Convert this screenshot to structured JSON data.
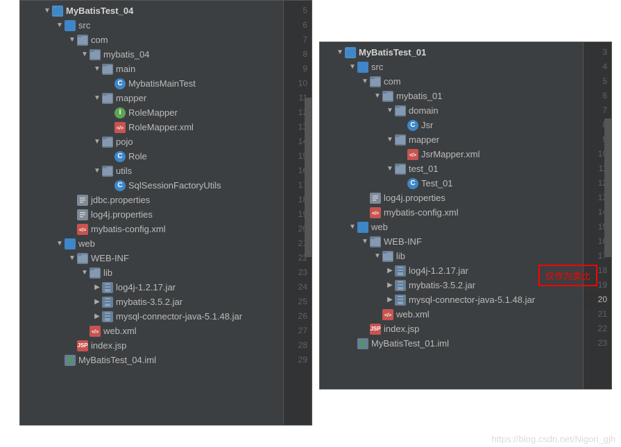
{
  "leftPanel": {
    "startLine": 5,
    "rows": [
      {
        "indent": 0,
        "arrow": "down",
        "icon": "module",
        "label": "MyBatisTest_04",
        "bold": true
      },
      {
        "indent": 1,
        "arrow": "down",
        "icon": "folder-src",
        "label": "src"
      },
      {
        "indent": 2,
        "arrow": "down",
        "icon": "package",
        "label": "com"
      },
      {
        "indent": 3,
        "arrow": "down",
        "icon": "package",
        "label": "mybatis_04"
      },
      {
        "indent": 4,
        "arrow": "down",
        "icon": "package",
        "label": "main"
      },
      {
        "indent": 5,
        "arrow": "",
        "icon": "class-c",
        "label": "MybatisMainTest"
      },
      {
        "indent": 4,
        "arrow": "down",
        "icon": "package",
        "label": "mapper"
      },
      {
        "indent": 5,
        "arrow": "",
        "icon": "class-i",
        "label": "RoleMapper"
      },
      {
        "indent": 5,
        "arrow": "",
        "icon": "xml",
        "label": "RoleMapper.xml"
      },
      {
        "indent": 4,
        "arrow": "down",
        "icon": "package",
        "label": "pojo"
      },
      {
        "indent": 5,
        "arrow": "",
        "icon": "class-c",
        "label": "Role"
      },
      {
        "indent": 4,
        "arrow": "down",
        "icon": "package",
        "label": "utils"
      },
      {
        "indent": 5,
        "arrow": "",
        "icon": "class-c",
        "label": "SqlSessionFactoryUtils"
      },
      {
        "indent": 2,
        "arrow": "",
        "icon": "prop",
        "label": "jdbc.properties"
      },
      {
        "indent": 2,
        "arrow": "",
        "icon": "prop",
        "label": "log4j.properties"
      },
      {
        "indent": 2,
        "arrow": "",
        "icon": "xml",
        "label": "mybatis-config.xml"
      },
      {
        "indent": 1,
        "arrow": "down",
        "icon": "folder-web",
        "label": "web"
      },
      {
        "indent": 2,
        "arrow": "down",
        "icon": "folder",
        "label": "WEB-INF"
      },
      {
        "indent": 3,
        "arrow": "down",
        "icon": "folder",
        "label": "lib"
      },
      {
        "indent": 4,
        "arrow": "right",
        "icon": "jar",
        "label": "log4j-1.2.17.jar"
      },
      {
        "indent": 4,
        "arrow": "right",
        "icon": "jar",
        "label": "mybatis-3.5.2.jar"
      },
      {
        "indent": 4,
        "arrow": "right",
        "icon": "jar",
        "label": "mysql-connector-java-5.1.48.jar"
      },
      {
        "indent": 3,
        "arrow": "",
        "icon": "xml",
        "label": "web.xml"
      },
      {
        "indent": 2,
        "arrow": "",
        "icon": "jsp",
        "label": "index.jsp"
      },
      {
        "indent": 1,
        "arrow": "",
        "icon": "iml",
        "label": "MyBatisTest_04.iml"
      }
    ]
  },
  "rightPanel": {
    "startLine": 3,
    "highlightLine": 20,
    "rows": [
      {
        "indent": 0,
        "arrow": "down",
        "icon": "module",
        "label": "MyBatisTest_01",
        "bold": true
      },
      {
        "indent": 1,
        "arrow": "down",
        "icon": "folder-src",
        "label": "src"
      },
      {
        "indent": 2,
        "arrow": "down",
        "icon": "package",
        "label": "com"
      },
      {
        "indent": 3,
        "arrow": "down",
        "icon": "package",
        "label": "mybatis_01"
      },
      {
        "indent": 4,
        "arrow": "down",
        "icon": "package",
        "label": "domain"
      },
      {
        "indent": 5,
        "arrow": "",
        "icon": "class-c",
        "label": "Jsr"
      },
      {
        "indent": 4,
        "arrow": "down",
        "icon": "package",
        "label": "mapper"
      },
      {
        "indent": 5,
        "arrow": "",
        "icon": "xml",
        "label": "JsrMapper.xml"
      },
      {
        "indent": 4,
        "arrow": "down",
        "icon": "package",
        "label": "test_01"
      },
      {
        "indent": 5,
        "arrow": "",
        "icon": "class-c",
        "label": "Test_01"
      },
      {
        "indent": 2,
        "arrow": "",
        "icon": "prop",
        "label": "log4j.properties"
      },
      {
        "indent": 2,
        "arrow": "",
        "icon": "xml",
        "label": "mybatis-config.xml"
      },
      {
        "indent": 1,
        "arrow": "down",
        "icon": "folder-web",
        "label": "web"
      },
      {
        "indent": 2,
        "arrow": "down",
        "icon": "folder",
        "label": "WEB-INF"
      },
      {
        "indent": 3,
        "arrow": "down",
        "icon": "folder",
        "label": "lib"
      },
      {
        "indent": 4,
        "arrow": "right",
        "icon": "jar",
        "label": "log4j-1.2.17.jar"
      },
      {
        "indent": 4,
        "arrow": "right",
        "icon": "jar",
        "label": "mybatis-3.5.2.jar"
      },
      {
        "indent": 4,
        "arrow": "right",
        "icon": "jar",
        "label": "mysql-connector-java-5.1.48.jar"
      },
      {
        "indent": 3,
        "arrow": "",
        "icon": "xml",
        "label": "web.xml"
      },
      {
        "indent": 2,
        "arrow": "",
        "icon": "jsp",
        "label": "index.jsp"
      },
      {
        "indent": 1,
        "arrow": "",
        "icon": "iml",
        "label": "MyBatisTest_01.iml"
      }
    ]
  },
  "annotation": {
    "text": "仅作为类比"
  },
  "watermark": {
    "text": "https://blog.csdn.net/Nigori_gjh"
  }
}
